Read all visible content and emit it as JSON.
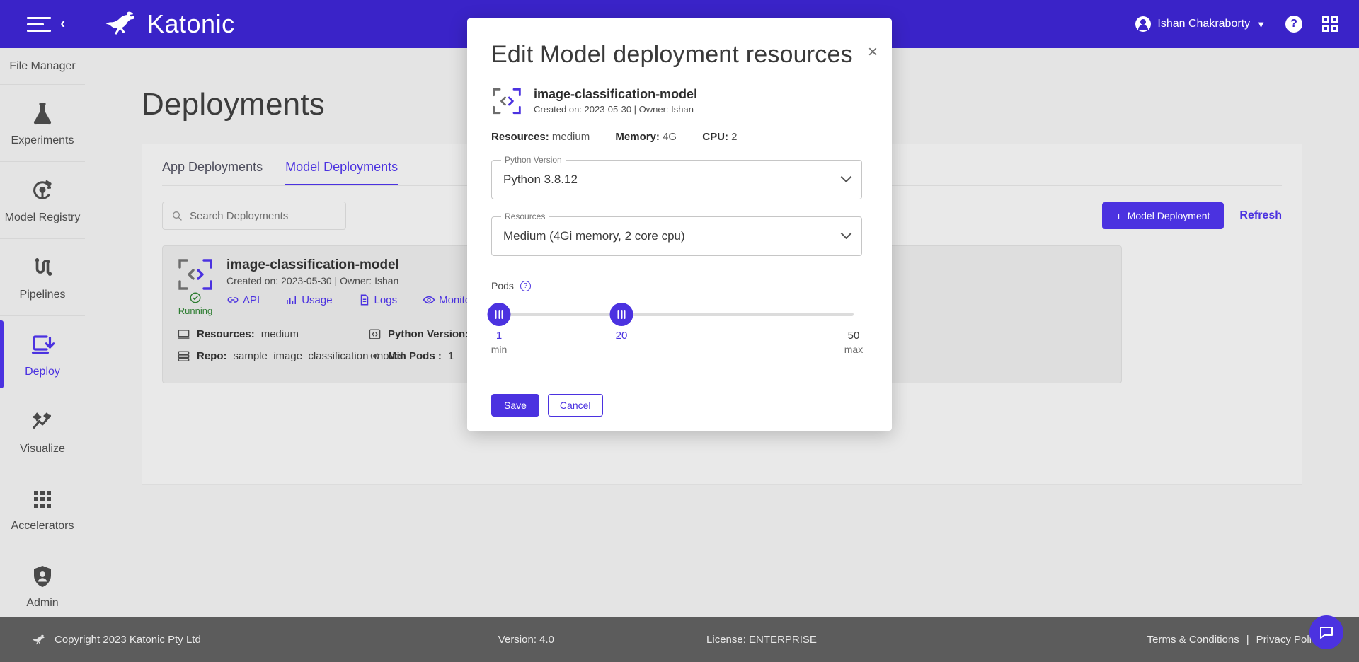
{
  "header": {
    "brand": "Katonic",
    "menu_icon": "hamburger-collapse-icon",
    "user_name": "Ishan Chakraborty",
    "help_icon": "question-mark-icon",
    "fullscreen_icon": "fullscreen-icon"
  },
  "sidebar": {
    "top_item": "File Manager",
    "items": [
      {
        "label": "Experiments",
        "icon": "flask-icon",
        "active": false
      },
      {
        "label": "Model Registry",
        "icon": "model-registry-icon",
        "active": false
      },
      {
        "label": "Pipelines",
        "icon": "pipelines-icon",
        "active": false
      },
      {
        "label": "Deploy",
        "icon": "deploy-icon",
        "active": true
      },
      {
        "label": "Visualize",
        "icon": "sparkle-chart-icon",
        "active": false
      },
      {
        "label": "Accelerators",
        "icon": "grid-dots-icon",
        "active": false
      },
      {
        "label": "Admin",
        "icon": "shield-person-icon",
        "active": false
      }
    ]
  },
  "main": {
    "page_title": "Deployments",
    "tabs": [
      {
        "label": "App Deployments",
        "active": false
      },
      {
        "label": "Model Deployments",
        "active": true
      }
    ],
    "search": {
      "placeholder": "Search Deployments",
      "icon": "search-icon"
    },
    "new_deployment_button": "Model Deployment",
    "new_deployment_plus": "+",
    "refresh_label": "Refresh",
    "card": {
      "name": "image-classification-model",
      "subtitle": "Created on: 2023-05-30 | Owner: Ishan",
      "status": "Running",
      "actions": [
        {
          "label": "API",
          "icon": "link-icon"
        },
        {
          "label": "Usage",
          "icon": "bar-chart-icon"
        },
        {
          "label": "Logs",
          "icon": "document-icon"
        },
        {
          "label": "Monitoring",
          "icon": "eye-icon"
        }
      ],
      "meta": [
        {
          "label": "Resources:",
          "value": "medium",
          "icon": "monitor-icon"
        },
        {
          "label": "Python Version:",
          "value": "",
          "icon": "code-icon"
        },
        {
          "label": "Repo:",
          "value": "sample_image_classification_model",
          "icon": "server-icon"
        },
        {
          "label": "Min Pods :",
          "value": "1",
          "icon": "pods-icon"
        }
      ]
    }
  },
  "modal": {
    "title": "Edit Model deployment resources",
    "close_icon": "close-icon",
    "model_name": "image-classification-model",
    "model_subtitle": "Created on: 2023-05-30 | Owner: Ishan",
    "resource_summary": [
      {
        "label": "Resources:",
        "value": "medium"
      },
      {
        "label": "Memory:",
        "value": "4G"
      },
      {
        "label": "CPU:",
        "value": "2"
      }
    ],
    "python_field": {
      "label": "Python Version",
      "value": "Python 3.8.12"
    },
    "resources_field": {
      "label": "Resources",
      "value": "Medium (4Gi memory, 2 core cpu)"
    },
    "pods": {
      "label": "Pods",
      "help_icon": "help-circle-icon",
      "min_handle_value": "1",
      "max_handle_value": "20",
      "scale_end_value": "50",
      "min_caption": "min",
      "max_caption": "max",
      "range_start": 1,
      "range_end": 50
    },
    "save_label": "Save",
    "cancel_label": "Cancel"
  },
  "footer": {
    "copyright": "Copyright 2023 Katonic Pty Ltd",
    "version": "Version: 4.0",
    "license": "License: ENTERPRISE",
    "terms": "Terms & Conditions",
    "separator": "|",
    "privacy": "Privacy Policy",
    "chat_icon": "chat-bubble-icon"
  },
  "colors": {
    "brand": "#3a23c8",
    "accent": "#4b32e0",
    "status_running": "#2e7d32"
  }
}
